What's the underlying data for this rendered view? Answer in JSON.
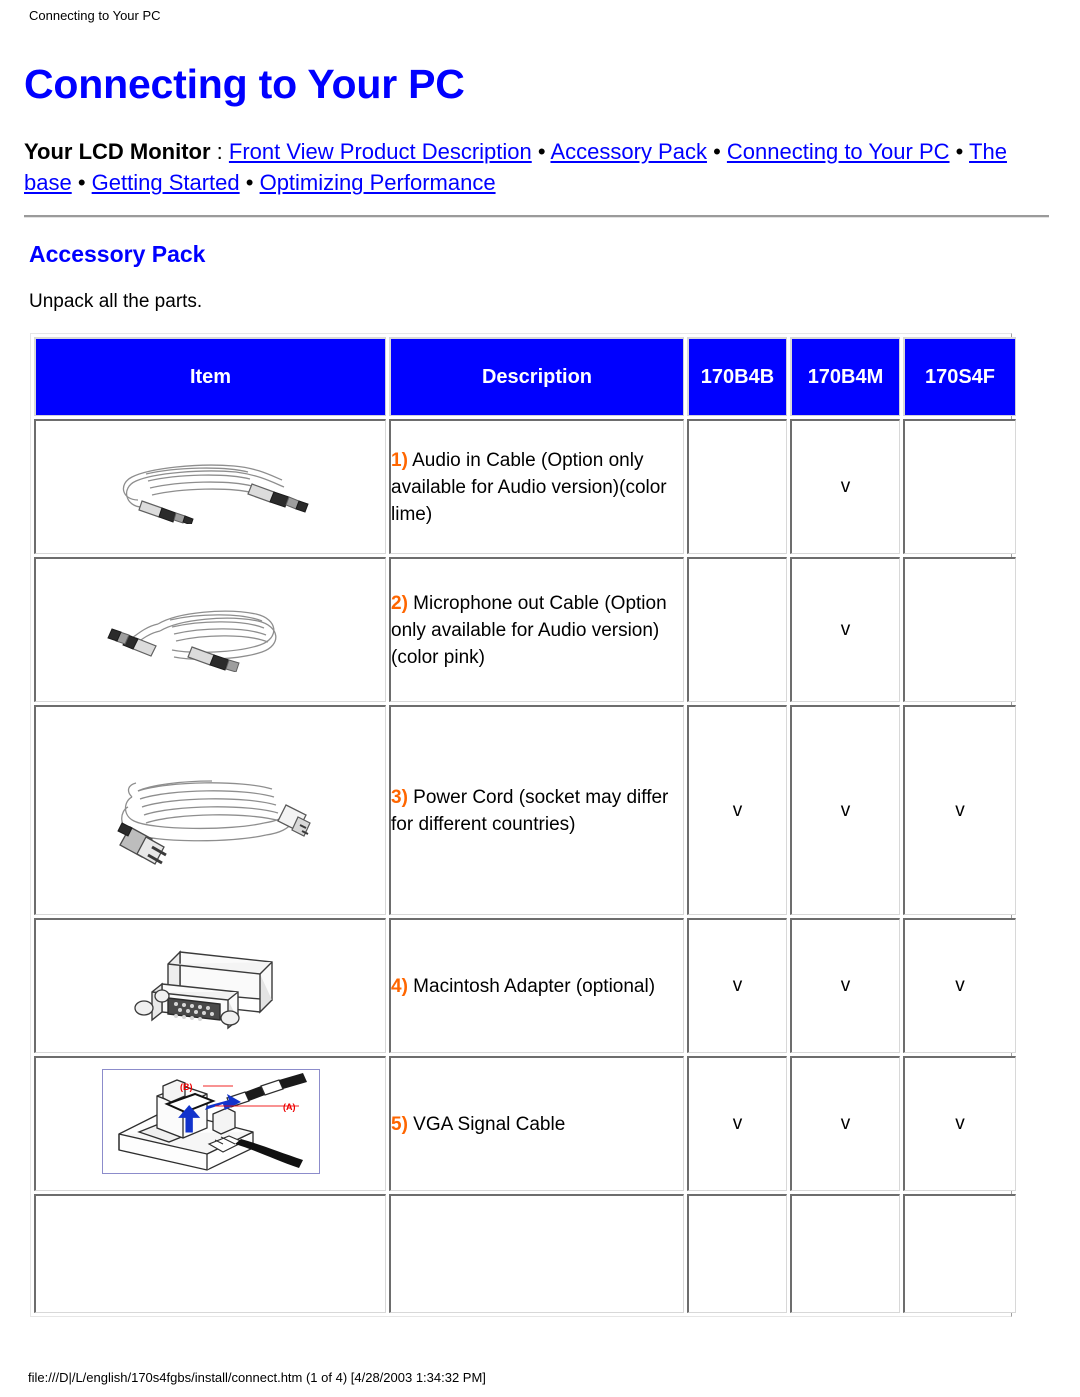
{
  "running_head": "Connecting to Your PC",
  "page_title": "Connecting to Your PC",
  "nav": {
    "lead": "Your LCD Monitor",
    "colon": " : ",
    "separator": " • ",
    "links": [
      "Front View Product Description",
      "Accessory Pack",
      "Connecting to Your PC",
      "The base",
      "Getting Started",
      "Optimizing Performance"
    ]
  },
  "section": {
    "title": "Accessory Pack",
    "intro": "Unpack all the parts."
  },
  "table": {
    "headers": [
      "Item",
      "Description",
      "170B4B",
      "170B4M",
      "170S4F"
    ],
    "check_glyph": "v",
    "rows": [
      {
        "icon": "audio-cable-icon",
        "num": "1)",
        "description": " Audio in Cable (Option only available for Audio version)(color lime)",
        "170B4B": "",
        "170B4M": "v",
        "170S4F": ""
      },
      {
        "icon": "microphone-cable-icon",
        "num": "2)",
        "description": " Microphone out Cable (Option only available for Audio version)(color pink)",
        "170B4B": "",
        "170B4M": "v",
        "170S4F": ""
      },
      {
        "icon": "power-cord-icon",
        "num": "3)",
        "description": " Power Cord (socket may differ for different countries)",
        "170B4B": "v",
        "170B4M": "v",
        "170S4F": "v"
      },
      {
        "icon": "macintosh-adapter-icon",
        "num": "4)",
        "description": " Macintosh Adapter (optional)",
        "170B4B": "v",
        "170B4M": "v",
        "170S4F": "v"
      },
      {
        "icon": "vga-signal-cable-icon",
        "num": "5)",
        "description": " VGA Signal Cable",
        "170B4B": "v",
        "170B4M": "v",
        "170S4F": "v",
        "callouts": [
          "(B)",
          "(A)"
        ]
      }
    ]
  },
  "footer": {
    "path": "file:///D|/L/english/170s4fgbs/install/connect.htm (1 of 4) [4/28/2003 1:34:32 PM]"
  },
  "colors": {
    "link": "#0000ff",
    "heading": "#0000ff",
    "header_bg": "#0000ff",
    "header_text": "#ffffff",
    "number_accent": "#ff6600",
    "callout_red": "#ee0000",
    "arrow_blue": "#1133cc"
  }
}
